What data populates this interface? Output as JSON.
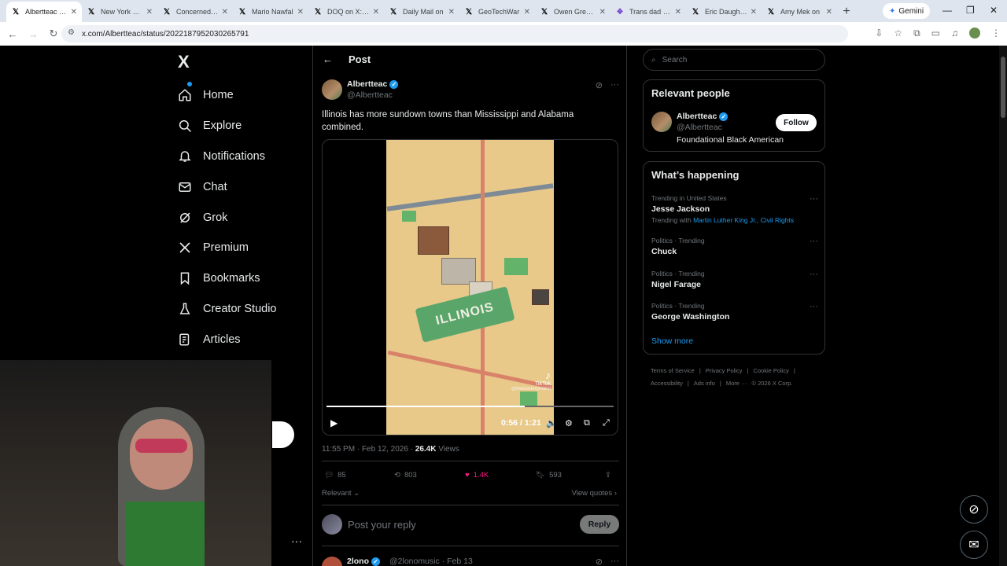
{
  "browser": {
    "tabs": [
      {
        "label": "Albertteac on X",
        "active": true
      },
      {
        "label": "New York Pos"
      },
      {
        "label": "Concerned Ci"
      },
      {
        "label": "Mario Nawfal"
      },
      {
        "label": "DOQ on X: \"N"
      },
      {
        "label": "Daily Mail on"
      },
      {
        "label": "GeoTechWar"
      },
      {
        "label": "Owen Gregor"
      },
      {
        "label": "Trans dad Rol"
      },
      {
        "label": "Eric Daughert"
      },
      {
        "label": "Amy Mek on"
      }
    ],
    "gemini_label": "Gemini",
    "url": "x.com/Albertteac/status/2022187952030265791"
  },
  "nav": {
    "logo": "X",
    "items": [
      {
        "label": "Home",
        "icon": "home-icon"
      },
      {
        "label": "Explore",
        "icon": "search-icon"
      },
      {
        "label": "Notifications",
        "icon": "bell-icon"
      },
      {
        "label": "Chat",
        "icon": "mail-icon"
      },
      {
        "label": "Grok",
        "icon": "grok-icon"
      },
      {
        "label": "Premium",
        "icon": "x-icon"
      },
      {
        "label": "Bookmarks",
        "icon": "bookmark-icon"
      },
      {
        "label": "Creator Studio",
        "icon": "flask-icon"
      },
      {
        "label": "Articles",
        "icon": "article-icon"
      }
    ]
  },
  "post": {
    "header_title": "Post",
    "author_name": "Albertteac",
    "author_handle": "@Albertteac",
    "text": "Illinois has more sundown towns than Mississippi and Alabama combined.",
    "video": {
      "badge_text": "ILLINOIS",
      "watermark": "TikTok",
      "watermark_handle": "@theborderprofect",
      "timecode": "0:56 / 1:21",
      "progress": 0.69
    },
    "timestamp": "11:55 PM · Feb 12, 2026 · ",
    "views_count": "26.4K",
    "views_label": " Views",
    "stats": {
      "replies": "85",
      "reposts": "803",
      "likes": "1.4K",
      "bookmarks": "593"
    },
    "relevant_label": "Relevant",
    "view_quotes_label": "View quotes",
    "reply_placeholder": "Post your reply",
    "reply_button": "Reply"
  },
  "next_post": {
    "author_name": "2lono",
    "author_handle": "@2lonomusic · Feb 13"
  },
  "sidebar": {
    "search_placeholder": "Search",
    "relevant_people_title": "Relevant people",
    "person": {
      "name": "Albertteac",
      "handle": "@Albertteac",
      "bio": "Foundational Black American",
      "follow_label": "Follow"
    },
    "happening_title": "What’s happening",
    "trends": [
      {
        "context": "Trending in United States",
        "name": "Jesse Jackson",
        "with_prefix": "Trending with ",
        "with_links": "Martin Luther King Jr., Civil Rights"
      },
      {
        "context": "Politics · Trending",
        "name": "Chuck"
      },
      {
        "context": "Politics · Trending",
        "name": "Nigel Farage"
      },
      {
        "context": "Politics · Trending",
        "name": "George Washington"
      }
    ],
    "show_more": "Show more",
    "footer_line1": [
      "Terms of Service",
      "|",
      "Privacy Policy",
      "|",
      "Cookie Policy",
      "|"
    ],
    "footer_line2": [
      "Accessibility",
      "|",
      "Ads info",
      "|",
      "More ···",
      "© 2026 X Corp."
    ]
  },
  "colors": {
    "accent": "#1d9bf0",
    "like": "#f91880",
    "border": "#2f3336",
    "muted": "#71767b"
  }
}
